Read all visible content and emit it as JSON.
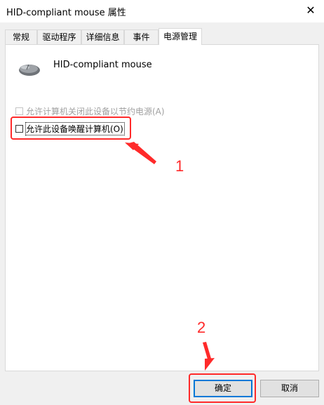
{
  "window": {
    "title": "HID-compliant mouse 属性",
    "close_glyph": "✕"
  },
  "tabs": [
    {
      "label": "常规"
    },
    {
      "label": "驱动程序"
    },
    {
      "label": "详细信息"
    },
    {
      "label": "事件"
    },
    {
      "label": "电源管理"
    }
  ],
  "active_tab": "电源管理",
  "device": {
    "name": "HID-compliant mouse",
    "icon": "mouse-icon"
  },
  "options": [
    {
      "label": "允许计算机关闭此设备以节约电源(A)",
      "checked": false,
      "enabled": false
    },
    {
      "label": "允许此设备唤醒计算机(O)",
      "checked": false,
      "enabled": true
    }
  ],
  "annotations": {
    "step1": "1",
    "step2": "2",
    "color": "#ff2a2a"
  },
  "buttons": {
    "ok": "确定",
    "cancel": "取消"
  }
}
